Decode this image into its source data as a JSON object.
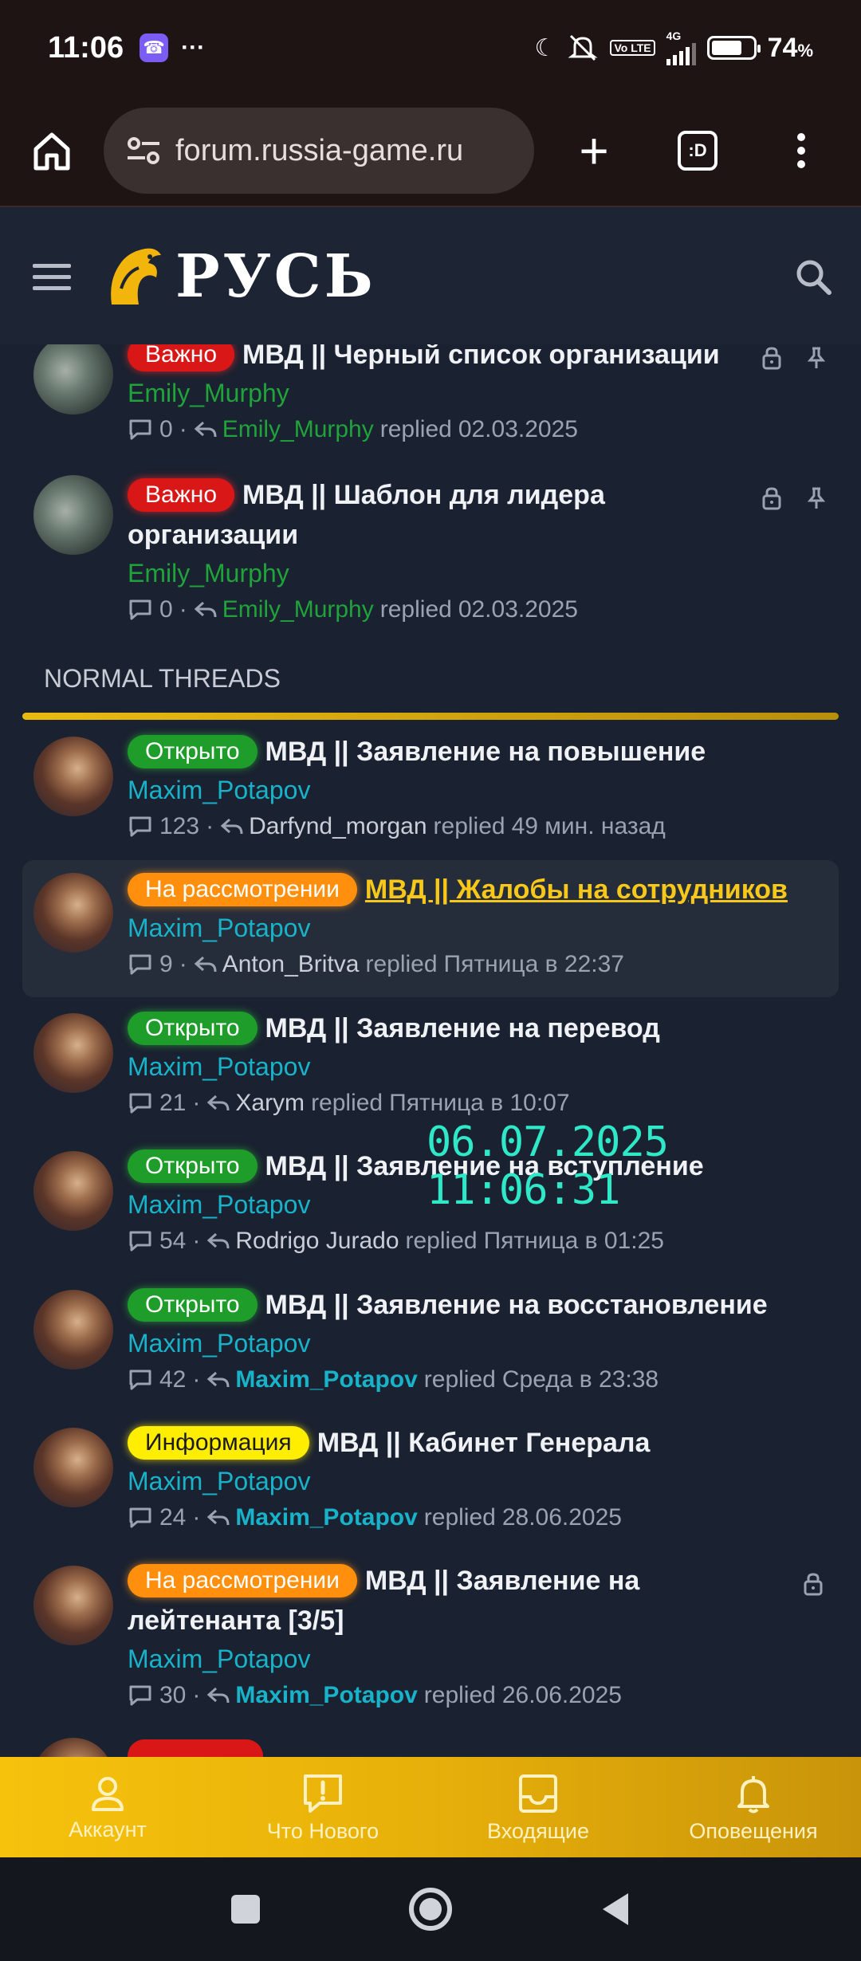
{
  "status_bar": {
    "time": "11:06",
    "network": "4G",
    "volte": "Vo LTE",
    "battery_percent": 74,
    "battery_label": "74",
    "battery_unit": "%"
  },
  "browser": {
    "url": "forum.russia-game.ru",
    "tabs_label": ":D"
  },
  "site": {
    "logo_text": "РУСЬ"
  },
  "timestamp_overlay": "06.07.2025 11:06:31",
  "sticky_threads": [
    {
      "badge": "Важно",
      "title": "МВД || Черный список организации",
      "author": "Emily_Murphy",
      "replies": "0",
      "last_replier": "Emily_Murphy",
      "replied_word": "replied",
      "date": "02.03.2025"
    },
    {
      "badge": "Важно",
      "title": "МВД || Шаблон для лидера организации",
      "author": "Emily_Murphy",
      "replies": "0",
      "last_replier": "Emily_Murphy",
      "replied_word": "replied",
      "date": "02.03.2025"
    }
  ],
  "section_header": "NORMAL THREADS",
  "threads": [
    {
      "badge": "Открыто",
      "title": "МВД || Заявление на повышение",
      "author": "Maxim_Potapov",
      "replies": "123",
      "last_replier": "Darfynd_morgan",
      "replied_word": "replied",
      "date": "49 мин. назад"
    },
    {
      "badge": "На рассмотрении",
      "title": "МВД || Жалобы на сотрудников",
      "author": "Maxim_Potapov",
      "replies": "9",
      "last_replier": "Anton_Britva",
      "replied_word": "replied",
      "date": "Пятница в 22:37"
    },
    {
      "badge": "Открыто",
      "title": "МВД || Заявление на перевод",
      "author": "Maxim_Potapov",
      "replies": "21",
      "last_replier": "Xarym",
      "replied_word": "replied",
      "date": "Пятница в 10:07"
    },
    {
      "badge": "Открыто",
      "title": "МВД || Заявление на вступление",
      "author": "Maxim_Potapov",
      "replies": "54",
      "last_replier": "Rodrigo Jurado",
      "replied_word": "replied",
      "date": "Пятница в 01:25"
    },
    {
      "badge": "Открыто",
      "title": "МВД || Заявление на восстановление",
      "author": "Maxim_Potapov",
      "replies": "42",
      "last_replier": "Maxim_Potapov",
      "replied_word": "replied",
      "date": "Среда в 23:38"
    },
    {
      "badge": "Информация",
      "title": "МВД || Кабинет Генерала",
      "author": "Maxim_Potapov",
      "replies": "24",
      "last_replier": "Maxim_Potapov",
      "replied_word": "replied",
      "date": "28.06.2025"
    },
    {
      "badge": "На рассмотрении",
      "title": "МВД || Заявление на лейтенанта [3/5]",
      "author": "Maxim_Potapov",
      "replies": "30",
      "last_replier": "Maxim_Potapov",
      "replied_word": "replied",
      "date": "26.06.2025"
    }
  ],
  "bottom_nav": [
    {
      "label": "Аккаунт",
      "icon": "user-icon"
    },
    {
      "label": "Что Нового",
      "icon": "alert-message-icon"
    },
    {
      "label": "Входящие",
      "icon": "inbox-icon"
    },
    {
      "label": "Оповещения",
      "icon": "bell-icon"
    }
  ],
  "colors": {
    "accent": "#f6c20c",
    "green_badge": "#1f9d2a",
    "red_badge": "#d91717",
    "orange_badge": "#ff8f0c",
    "yellow_badge": "#ffee00",
    "author_cyan": "#19b3c9",
    "author_green": "#1fa33a",
    "timestamp": "#2ee8c8"
  }
}
